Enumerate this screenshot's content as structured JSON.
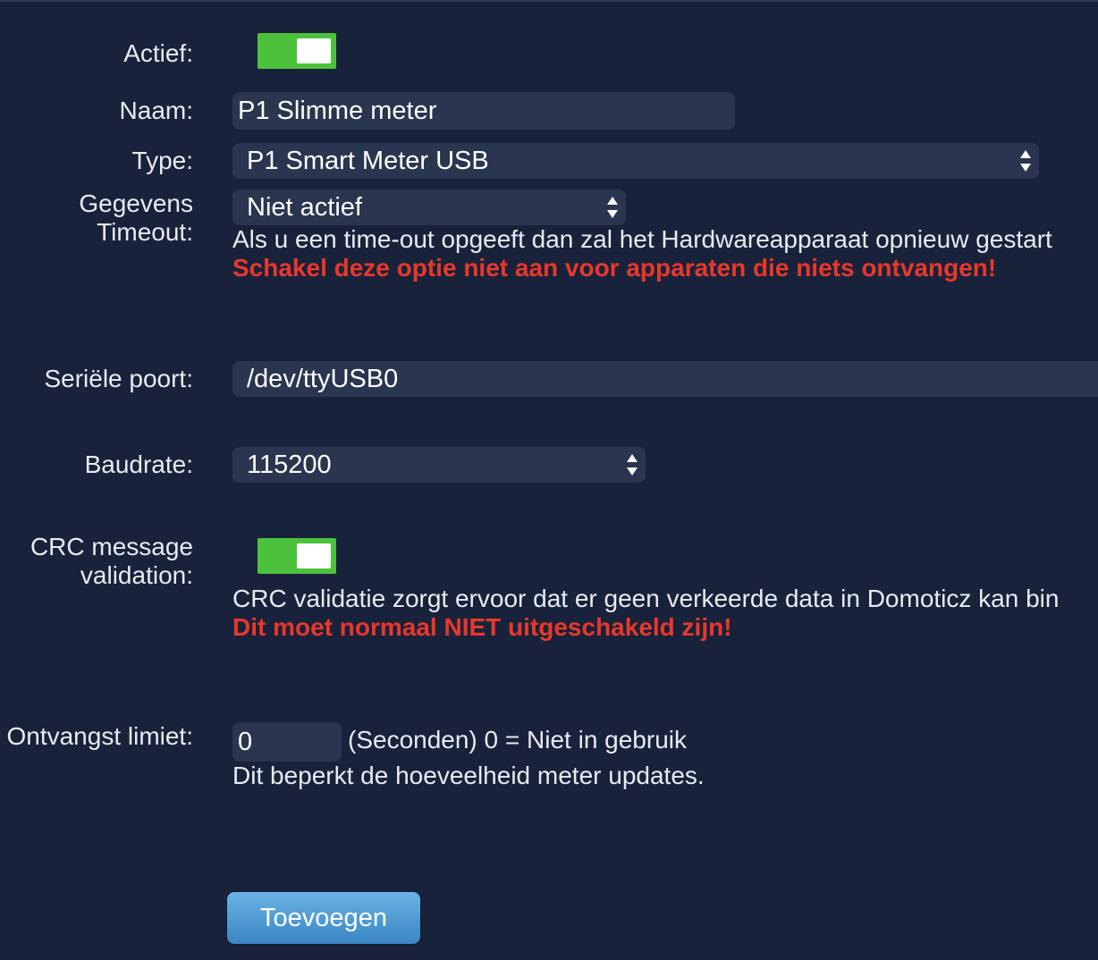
{
  "form": {
    "active": {
      "label": "Actief:",
      "checked": true
    },
    "name": {
      "label": "Naam:",
      "value": "P1 Slimme meter"
    },
    "type": {
      "label": "Type:",
      "value": "P1 Smart Meter USB"
    },
    "timeout": {
      "label_line1": "Gegevens",
      "label_line2": "Timeout:",
      "value": "Niet actief",
      "help": "Als u een time-out opgeeft dan zal het Hardwareapparaat opnieuw gestart",
      "warning": "Schakel deze optie niet aan voor apparaten die niets ontvangen!"
    },
    "serial_port": {
      "label": "Seriële poort:",
      "value": "/dev/ttyUSB0"
    },
    "baudrate": {
      "label": "Baudrate:",
      "value": "115200"
    },
    "crc": {
      "label_line1": "CRC message",
      "label_line2": "validation:",
      "checked": true,
      "help": "CRC validatie zorgt ervoor dat er geen verkeerde data in Domoticz kan bin",
      "warning": "Dit moet normaal NIET uitgeschakeld zijn!"
    },
    "receive_limit": {
      "label": "Ontvangst limiet:",
      "value": "0",
      "unit_note": "(Seconden) 0 = Niet in gebruik",
      "help": "Dit beperkt de hoeveelheid meter updates."
    },
    "add_button": "Toevoegen"
  },
  "colors": {
    "background": "#18223b",
    "input_bg": "#2a3550",
    "toggle_on": "#4cc23c",
    "warning": "#e8382a",
    "button": "#4a9bd4"
  }
}
